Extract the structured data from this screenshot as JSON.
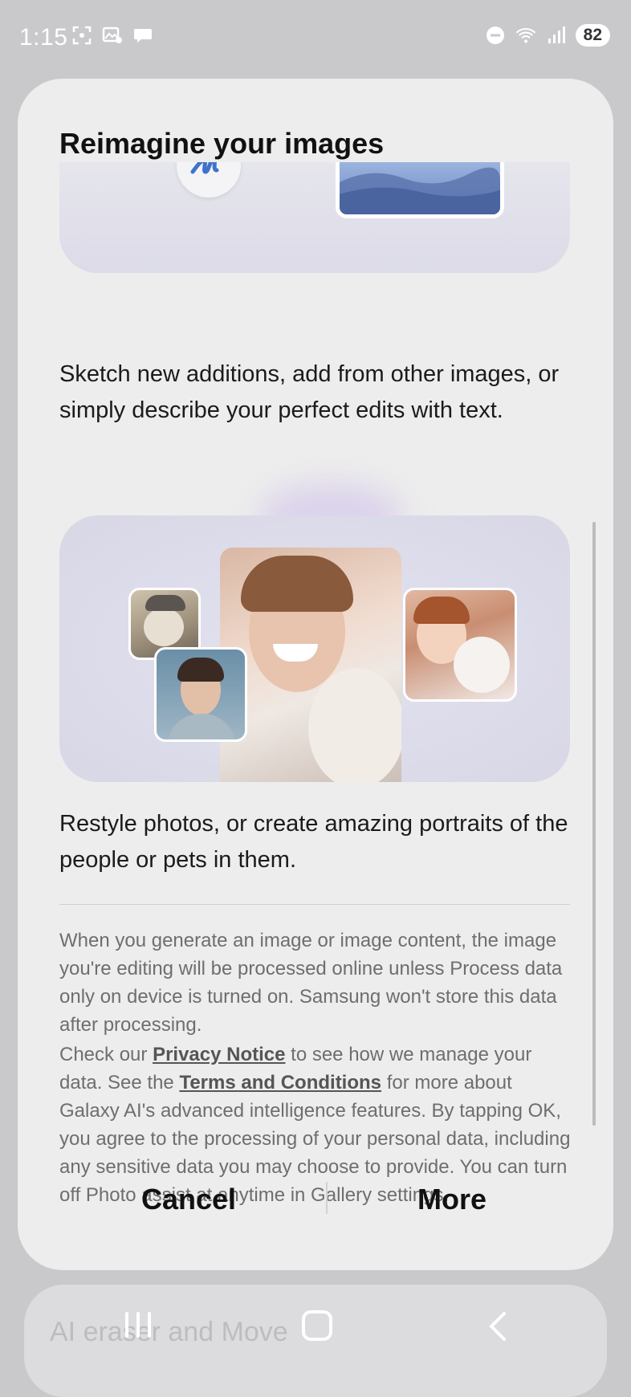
{
  "status_bar": {
    "time": "1:15",
    "battery": "82",
    "icons": [
      "screenshot-icon",
      "photo-settings-icon",
      "chat-icon",
      "do-not-disturb-icon",
      "wifi-icon",
      "signal-icon",
      "battery-icon"
    ]
  },
  "background": {
    "card_text": "AI eraser and Move"
  },
  "dialog": {
    "title": "Reimagine your images",
    "desc_1": "Sketch new additions, add from other images, or simply describe your perfect edits with text.",
    "desc_2": "Restyle photos, or create amazing portraits of the people or pets in them.",
    "legal_1": "When you generate an image or image content, the image you're editing will be processed online unless Process data only on device is turned on. Samsung won't store this data after processing.",
    "legal_2": {
      "prefix": "Check our ",
      "privacy_link": "Privacy Notice",
      "mid": " to see how we manage your data. See the ",
      "terms_link": "Terms and Conditions",
      "suffix": " for more about Galaxy AI's advanced intelligence features. By tapping OK, you agree to the processing of your personal data, including any sensitive data you may choose to provide. You can turn off Photo assist at anytime in Gallery settings."
    },
    "buttons": {
      "cancel": "Cancel",
      "more": "More"
    }
  },
  "colors": {
    "dialog_bg": "#ededed",
    "legal_text": "#6e6e6e",
    "sketch_blue": "#3f73c9"
  }
}
